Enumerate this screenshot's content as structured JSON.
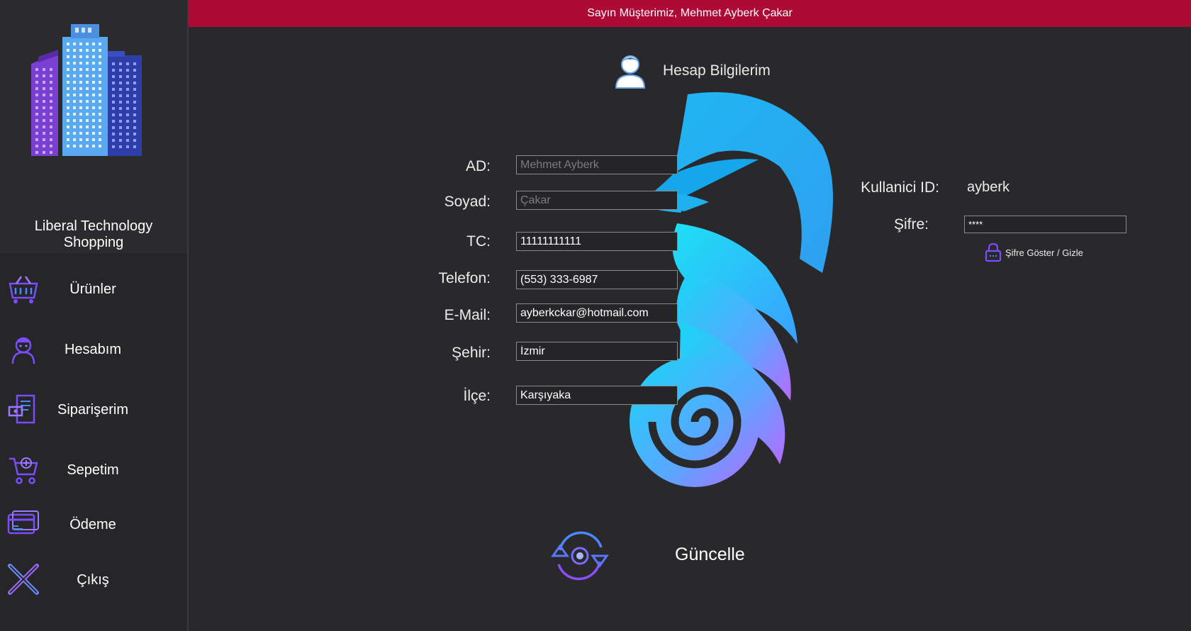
{
  "header": {
    "greeting": "Sayın Müşterimiz, Mehmet Ayberk Çakar"
  },
  "brand": {
    "line1": "Liberal Technology",
    "line2": "Shopping"
  },
  "sidebar": {
    "items": [
      {
        "label": "Ürünler",
        "icon": "shopping-basket-icon"
      },
      {
        "label": "Hesabım",
        "icon": "user-account-icon"
      },
      {
        "label": "Siparişerim",
        "icon": "order-receipt-icon"
      },
      {
        "label": "Sepetim",
        "icon": "cart-add-icon"
      },
      {
        "label": "Ödeme",
        "icon": "credit-card-icon"
      },
      {
        "label": "Çıkış",
        "icon": "close-icon"
      }
    ]
  },
  "account": {
    "title": "Hesap Bilgilerim",
    "icon": "user-profile-icon"
  },
  "form": {
    "ad": {
      "label": "AD:",
      "value": "",
      "placeholder": "Mehmet Ayberk"
    },
    "soyad": {
      "label": "Soyad:",
      "value": "",
      "placeholder": "Çakar"
    },
    "tc": {
      "label": "TC:",
      "value": "11111111111"
    },
    "telefon": {
      "label": "Telefon:",
      "value": "(553) 333-6987"
    },
    "email": {
      "label": "E-Mail:",
      "value": "ayberkckar@hotmail.com"
    },
    "sehir": {
      "label": "Şehir:",
      "value": "İzmir"
    },
    "ilce": {
      "label": "İlçe:",
      "value": "Karşıyaka"
    }
  },
  "credentials": {
    "user_id_label": "Kullanici ID:",
    "user_id_value": "ayberk",
    "password_label": "Şifre:",
    "password_value": "****",
    "toggle_label": "Şifre Göster / Gizle"
  },
  "update": {
    "label": "Güncelle",
    "icon": "refresh-icon"
  },
  "colors": {
    "header_bg": "#ad0a36",
    "body_bg": "#29282b",
    "sidebar_bg": "#262528",
    "icon_purple": "#7b4dff",
    "seahorse_cyan": "#19c2f5"
  }
}
